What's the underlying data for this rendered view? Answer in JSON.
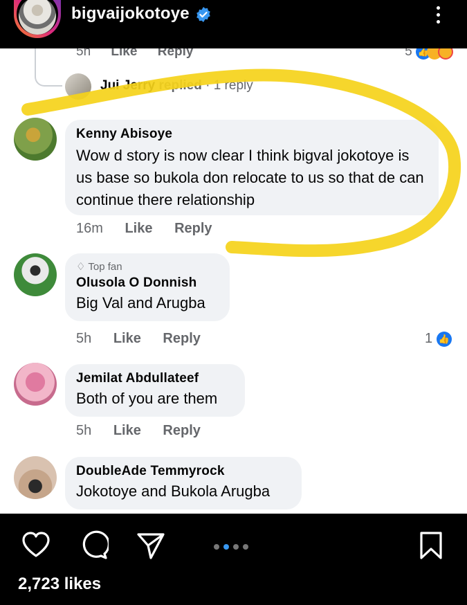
{
  "header": {
    "username": "bigvaijokotoye",
    "icons": {
      "verified": "verified-badge-icon",
      "more": "more-options-icon"
    }
  },
  "fb": {
    "prev_actions": {
      "time": "5h",
      "like": "Like",
      "reply": "Reply",
      "reaction_count": "5"
    },
    "reply_thread": {
      "name": "Jui Jerry",
      "verb": "replied",
      "count": "· 1 reply"
    },
    "comments": [
      {
        "name": "Kenny Abisoye",
        "text": "Wow d story is now clear I think bigval jokotoye is us base so bukola don relocate to us so that de can continue there relationship",
        "time": "16m",
        "like": "Like",
        "reply": "Reply"
      },
      {
        "badge": "Top fan",
        "name": "Olusola O Donnish",
        "text": "Big Val and Arugba",
        "time": "5h",
        "like": "Like",
        "reply": "Reply",
        "reaction_count": "1"
      },
      {
        "name": "Jemilat Abdullateef",
        "text": "Both of you are them",
        "time": "5h",
        "like": "Like",
        "reply": "Reply"
      },
      {
        "name": "DoubleAde Temmyrock",
        "text": "Jokotoye and Bukola Arugba"
      }
    ]
  },
  "footer": {
    "likes": "2,723 likes",
    "icons": [
      "heart-icon",
      "comment-icon",
      "share-icon",
      "save-icon"
    ]
  },
  "colors": {
    "highlight": "#f5d21a",
    "fb_blue": "#1877f2",
    "bubble": "#f0f2f5"
  }
}
